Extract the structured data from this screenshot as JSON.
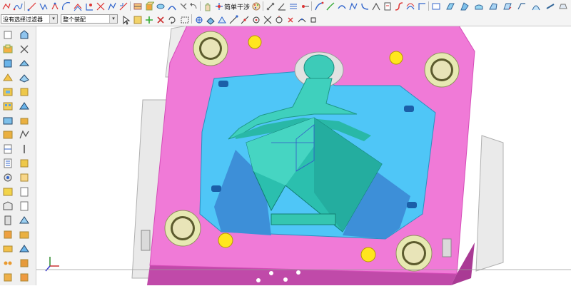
{
  "toolbar": {
    "snap_label": "简单干涉"
  },
  "selection_bar": {
    "filter_value": "没有选择过滤器",
    "scope_value": "整个装配"
  },
  "colors": {
    "plate": "#f07ad7",
    "plate_side": "#c04aa9",
    "cavity_floor": "#4fc6f7",
    "core": "#37c9b4",
    "bushing": "#e7e9b2",
    "pin": "#ffe61e"
  }
}
